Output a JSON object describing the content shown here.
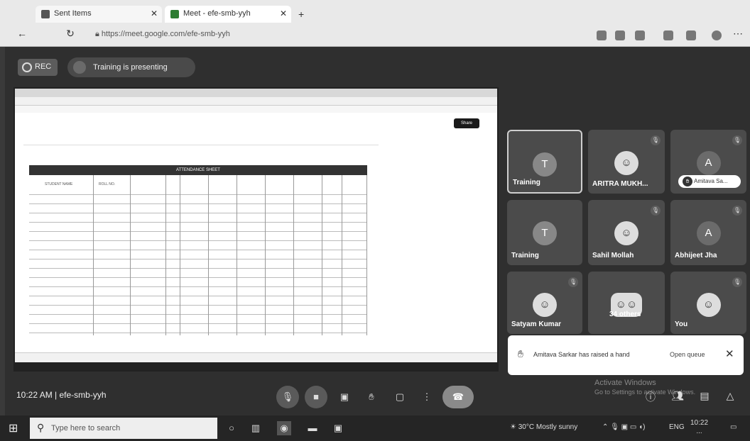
{
  "browser": {
    "tabs": [
      {
        "label": "Sent Items"
      },
      {
        "label": "Meet - efe-smb-yyh"
      }
    ],
    "address": "https://meet.google.com/efe-smb-yyh"
  },
  "meet": {
    "rec_label": "REC",
    "presenting_text": "Training is presenting",
    "meeting_time": "10:22 AM",
    "meeting_code": "efe-smb-yyh",
    "participants": [
      {
        "name": "Training",
        "initial": "T",
        "active": true
      },
      {
        "name": "ARITRA MUKH...",
        "initial": "",
        "hand_pill": "Amitava Sa..."
      },
      {
        "name": "",
        "initial": "A"
      },
      {
        "name": "Training",
        "initial": "T"
      },
      {
        "name": "Sahil Mollah",
        "initial": ""
      },
      {
        "name": "Abhijeet Jha",
        "initial": "A"
      },
      {
        "name": "Satyam Kumar",
        "initial": ""
      },
      {
        "name": "34 others",
        "initial": ""
      },
      {
        "name": "You",
        "initial": ""
      }
    ],
    "notification": {
      "message": "Amitava Sarkar has raised a hand",
      "open_label": "Open queue"
    },
    "watermark": [
      "Activate Windows",
      "Go to Settings to activate Windows."
    ]
  },
  "shared_sheet": {
    "header_title": "ATTENDANCE SHEET",
    "col_headers": [
      "STUDENT NAME",
      "ROLL NO."
    ],
    "share_label": "Share",
    "rows": [
      "",
      "",
      "",
      "",
      "",
      "",
      "",
      "",
      "",
      "",
      "",
      "",
      "",
      "",
      ""
    ]
  },
  "taskbar": {
    "search_placeholder": "Type here to search",
    "weather": "30°C  Mostly sunny",
    "lang": "ENG",
    "time": "10:22",
    "date": "..."
  }
}
